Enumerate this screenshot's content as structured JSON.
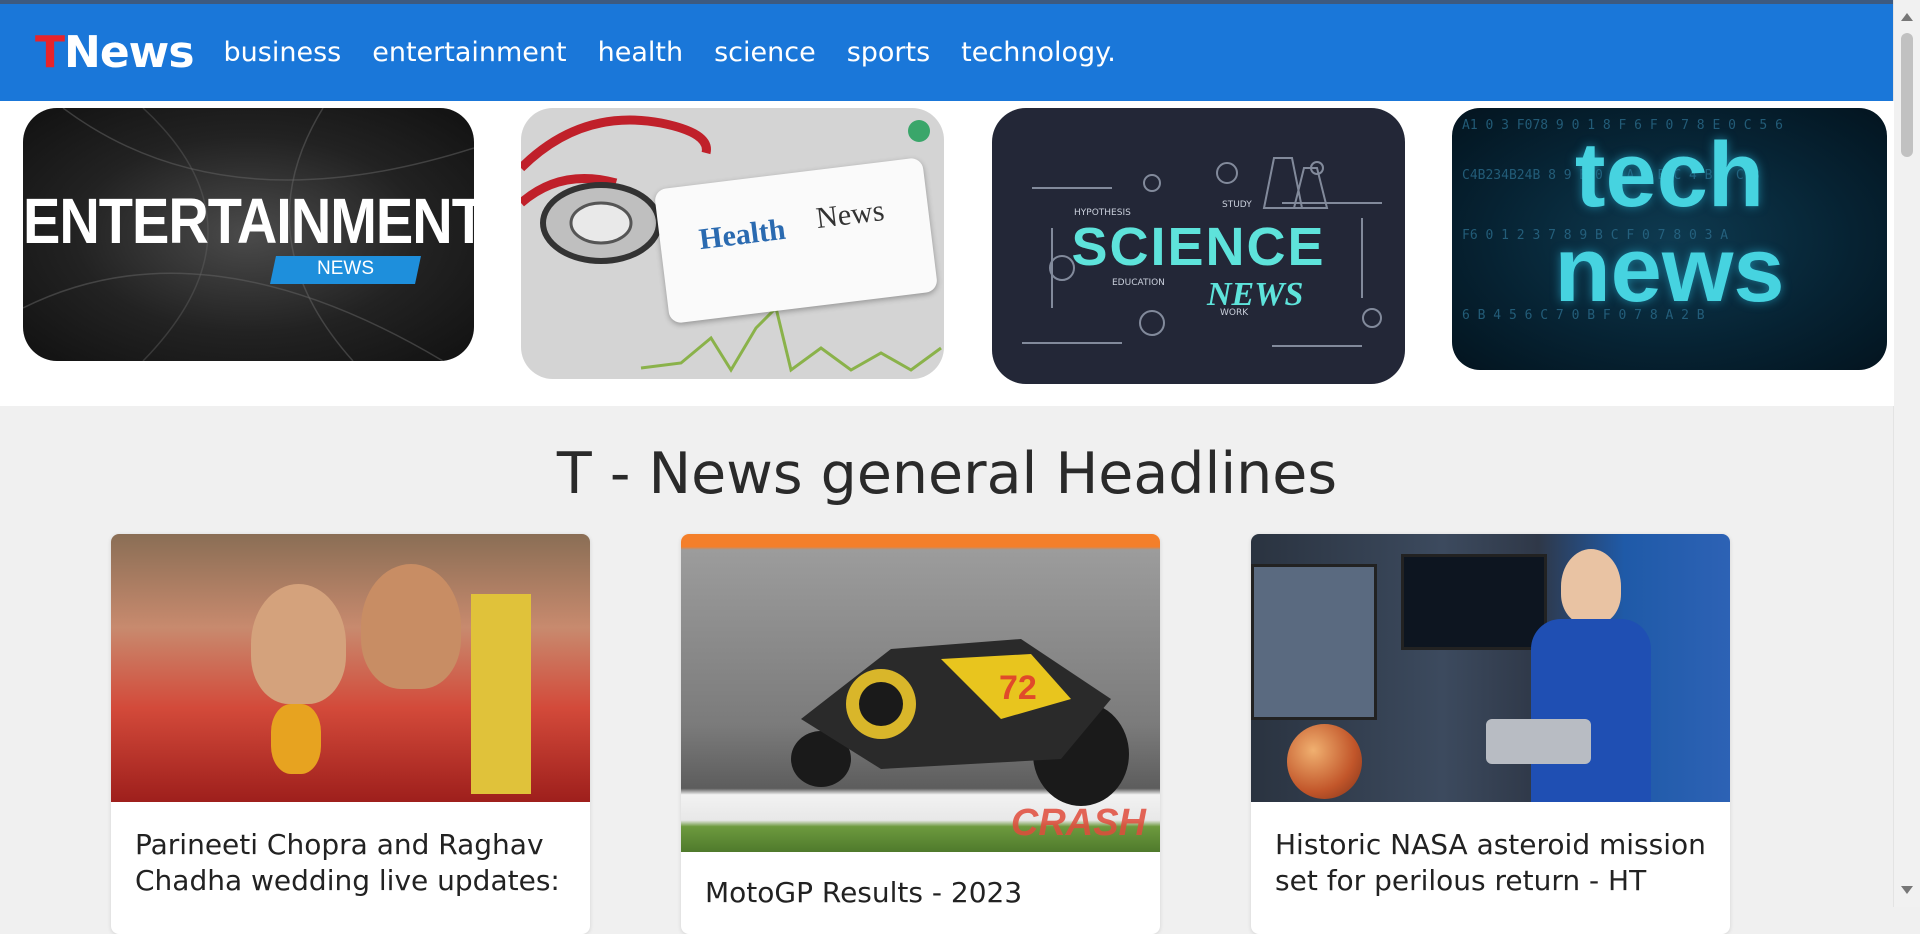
{
  "navbar": {
    "brand": {
      "t": "T",
      "rest": "News"
    },
    "links": [
      "business",
      "entertainment",
      "health",
      "science",
      "sports",
      "technology."
    ]
  },
  "carousel": {
    "entertainment": {
      "main": "ENTERTAINMENT",
      "sub": "NEWS"
    },
    "health": {
      "word1": "Health",
      "word2": "News"
    },
    "science": {
      "main": "SCIENCE",
      "sub": "NEWS",
      "labels": [
        "HYPOTHESIS",
        "STUDY",
        "EDUCATION",
        "WORK"
      ]
    },
    "tech": {
      "line1": "tech",
      "line2": "news"
    }
  },
  "section": {
    "title": "T - News general Headlines"
  },
  "cards": [
    {
      "title": "Parineeti Chopra and Raghav Chadha wedding live updates:"
    },
    {
      "title": "MotoGP Results - 2023",
      "watermark": "CRASH"
    },
    {
      "title": "Historic NASA asteroid mission set for perilous return - HT"
    }
  ],
  "colors": {
    "navbar": "#1a77d9",
    "brand_t": "#e8232a",
    "background": "#f0f0f0"
  }
}
